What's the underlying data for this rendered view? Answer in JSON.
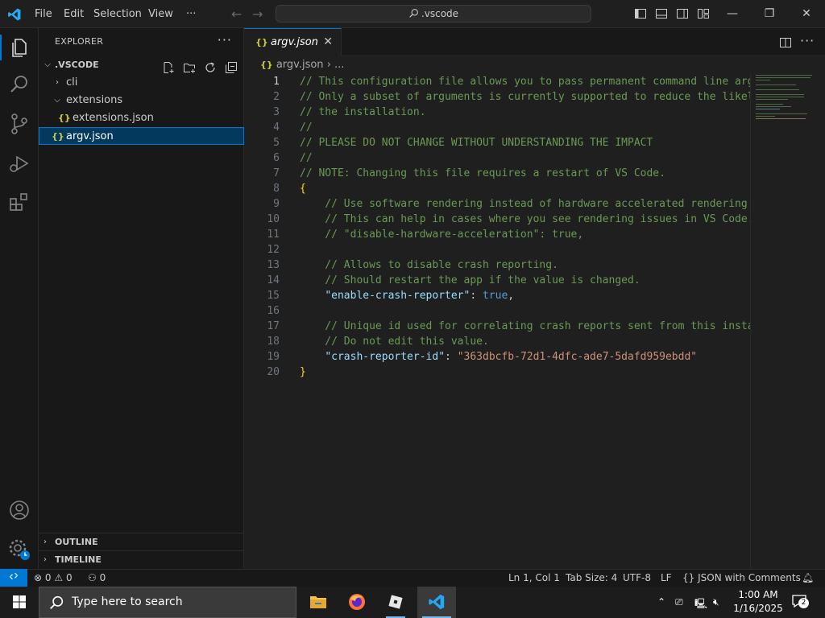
{
  "titlebar": {
    "menus": [
      "File",
      "Edit",
      "Selection",
      "View",
      "···"
    ],
    "search_text": ".vscode"
  },
  "explorer": {
    "title": "EXPLORER",
    "more": "···",
    "root": ".VSCODE",
    "items": [
      {
        "label": "cli"
      },
      {
        "label": "extensions"
      },
      {
        "label": "extensions.json"
      },
      {
        "label": "argv.json"
      }
    ],
    "json_icon": "{}",
    "sections": [
      "OUTLINE",
      "TIMELINE"
    ]
  },
  "editor": {
    "tab_label": "argv.json",
    "tab_close": "✕",
    "breadcrumb_file": "argv.json",
    "breadcrumb_more": "› ...",
    "line_numbers": [
      "1",
      "2",
      "3",
      "4",
      "5",
      "6",
      "7",
      "8",
      "9",
      "10",
      "11",
      "12",
      "13",
      "14",
      "15",
      "16",
      "17",
      "18",
      "19",
      "20"
    ],
    "lines": {
      "l1": "// This configuration file allows you to pass permanent command line argu",
      "l2": "// Only a subset of arguments is currently supported to reduce the likel",
      "l3": "// the installation.",
      "l4": "//",
      "l5": "// PLEASE DO NOT CHANGE WITHOUT UNDERSTANDING THE IMPACT",
      "l6": "//",
      "l7": "// NOTE: Changing this file requires a restart of VS Code.",
      "l8": "{",
      "l9": "    // Use software rendering instead of hardware accelerated rendering.",
      "l10": "    // This can help in cases where you see rendering issues in VS Code.",
      "l11": "    // \"disable-hardware-acceleration\": true,",
      "l13": "    // Allows to disable crash reporting.",
      "l14": "    // Should restart the app if the value is changed.",
      "l15_key": "\"enable-crash-reporter\"",
      "l15_colon": ": ",
      "l15_val": "true",
      "l15_end": ",",
      "l17": "    // Unique id used for correlating crash reports sent from this instan",
      "l18": "    // Do not edit this value.",
      "l19_key": "\"crash-reporter-id\"",
      "l19_colon": ": ",
      "l19_val": "\"363dbcfb-72d1-4dfc-ade7-5dafd959ebdd\"",
      "l20": "}"
    }
  },
  "statusbar": {
    "errors": "0",
    "warnings": "0",
    "ports": "0",
    "position": "Ln 1, Col 1",
    "tab_size": "Tab Size: 4",
    "encoding": "UTF-8",
    "eol": "LF",
    "language": "JSON with Comments"
  },
  "taskbar": {
    "search_placeholder": "Type here to search",
    "time": "1:00 AM",
    "date": "1/16/2025",
    "notifications": "2"
  },
  "colors": {
    "accent": "#0078d4",
    "comment": "#6a9955",
    "key": "#9cdcfe",
    "string": "#ce9178",
    "boolean": "#569cd6",
    "json_icon": "#cbcb41"
  }
}
